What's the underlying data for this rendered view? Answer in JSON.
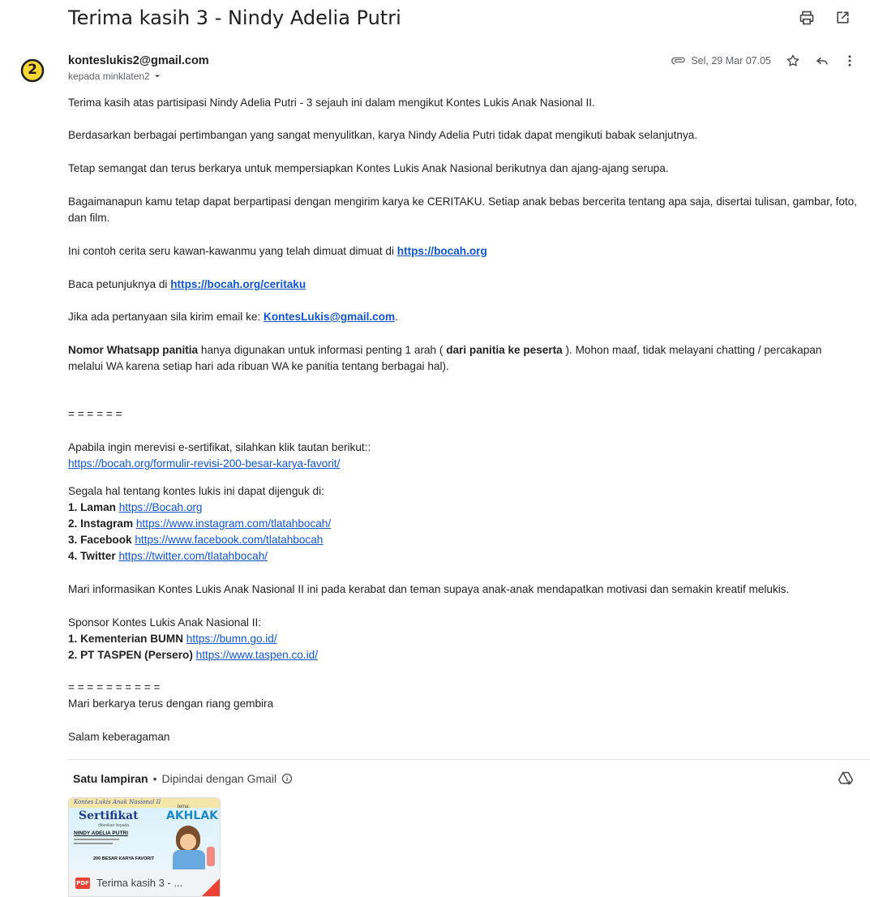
{
  "subject": "Terima kasih 3 - Nindy Adelia Putri",
  "header": {
    "sender": "konteslukis2@gmail.com",
    "to": "kepada minklaten2",
    "date": "Sel, 29 Mar 07.05",
    "avatar_icon": "number-2-avatar-icon",
    "avatar_text": "2"
  },
  "body": {
    "p1": "Terima kasih atas partisipasi Nindy Adelia Putri - 3 sejauh ini dalam mengikut Kontes Lukis Anak Nasional II.",
    "p2": "Berdasarkan berbagai pertimbangan yang sangat menyulitkan, karya Nindy Adelia Putri tidak dapat mengikuti babak selanjutnya.",
    "p3": "Tetap semangat dan terus berkarya untuk mempersiapkan Kontes Lukis Anak Nasional berikutnya dan ajang-ajang serupa.",
    "p4": "Bagaimanapun kamu tetap dapat berpartipasi dengan mengirim karya ke CERITAKU. Setiap anak bebas bercerita tentang apa saja, disertai tulisan, gambar, foto, dan film.",
    "p5_text": "Ini contoh cerita seru kawan-kawanmu yang telah dimuat dimuat di ",
    "p5_link": "https://bocah.org",
    "p6_text": "Baca petunjuknya di ",
    "p6_link": "https://bocah.org/ceritaku",
    "p7_text": "Jika ada pertanyaan sila kirim email ke: ",
    "p7_link": "KontesLukis@gmail.com",
    "p7_end": ".",
    "p8_bold1": "Nomor Whatsapp panitia",
    "p8_text1": " hanya digunakan untuk informasi penting 1 arah ( ",
    "p8_bold2": "dari panitia ke peserta",
    "p8_text2": " ). Mohon maaf, tidak melayani chatting / percakapan melalui WA karena setiap hari ada ribuan WA ke panitia tentang berbagai hal).",
    "sep1": "= = = = = =",
    "revisi_text": "Apabila ingin merevisi e-sertifikat, silahkan klik tautan berikut::",
    "revisi_link": "https://bocah.org/formulir-revisi-200-besar-karya-favorit/",
    "social_intro": "Segala hal tentang kontes lukis ini dapat dijenguk di:",
    "social": [
      {
        "label": "1. Laman",
        "link": "https://Bocah.org"
      },
      {
        "label": "2. Instagram",
        "link": "https://www.instagram.com/tlatahbocah/"
      },
      {
        "label": "3. Facebook",
        "link": "https://www.facebook.com/tlatahbocah"
      },
      {
        "label": "4. Twitter",
        "link": "https://twitter.com/tlatahbocah/"
      }
    ],
    "info": "Mari informasikan Kontes Lukis Anak Nasional II ini pada kerabat dan teman supaya anak-anak mendapatkan motivasi dan semakin kreatif melukis.",
    "sponsor_intro": "Sponsor Kontes Lukis Anak Nasional II:",
    "sponsors": [
      {
        "label": "1. Kementerian BUMN",
        "link": "https://bumn.go.id/"
      },
      {
        "label": "2. PT TASPEN (Persero)",
        "link": "https://www.taspen.co.id/"
      }
    ],
    "sep2": "= = = = = = = = = =",
    "closing1": "Mari berkarya terus dengan riang gembira",
    "closing2": "Salam keberagaman"
  },
  "attachments": {
    "title": "Satu lampiran",
    "dot": "•",
    "scan_note": "Dipindai dengan Gmail",
    "file_name": "Terima kasih 3 - ...",
    "file_badge": "PDF",
    "preview": {
      "header": "Kontes Lukis Anak Nasional II",
      "tema": "tema:",
      "theme": "AKHLAK",
      "title": "Sertifikat",
      "subtitle": "diberikan kepada",
      "name": "NINDY ADELIA PUTRI",
      "rank": "200 BESAR KARYA FAVORIT"
    }
  },
  "colors": {
    "link": "#1155cc",
    "pdf_red": "#ea4335",
    "icon_grey": "#444746"
  }
}
